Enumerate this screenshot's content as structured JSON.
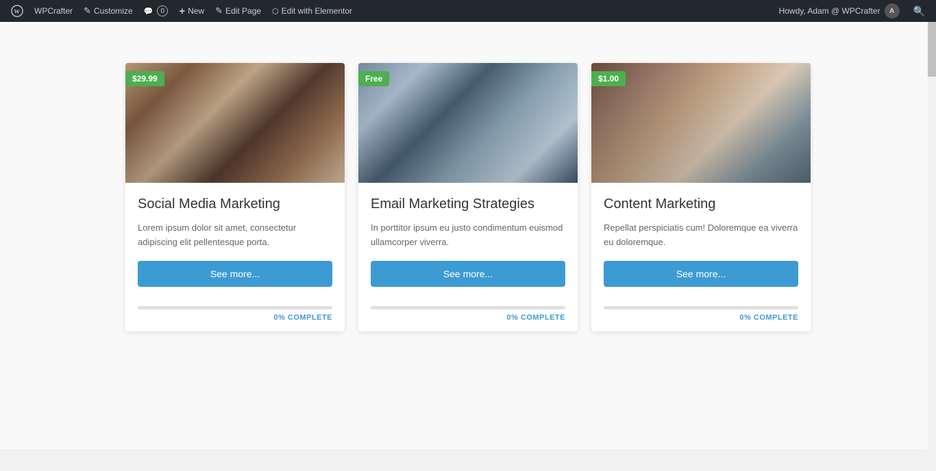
{
  "adminbar": {
    "wp_logo": "W",
    "site_name": "WPCrafter",
    "customize_label": "Customize",
    "comments_label": "0",
    "new_label": "New",
    "edit_page_label": "Edit Page",
    "edit_elementor_label": "Edit with Elementor",
    "howdy_text": "Howdy, Adam @ WPCrafter",
    "search_icon": "search"
  },
  "cards": [
    {
      "id": "card-1",
      "price": "$29.99",
      "title": "Social Media Marketing",
      "description": "Lorem ipsum dolor sit amet, consectetur adipiscing elit pellentesque porta.",
      "button_label": "See more...",
      "progress": 0,
      "complete_label": "0% COMPLETE",
      "img_class": "card-img-1"
    },
    {
      "id": "card-2",
      "price": "Free",
      "title": "Email Marketing Strategies",
      "description": "In porttitor ipsum eu justo condimentum euismod ullamcorper viverra.",
      "button_label": "See more...",
      "progress": 0,
      "complete_label": "0% COMPLETE",
      "img_class": "card-img-2"
    },
    {
      "id": "card-3",
      "price": "$1.00",
      "title": "Content Marketing",
      "description": "Repellat perspiciatis cum! Doloremque ea viverra eu doloremque.",
      "button_label": "See more...",
      "progress": 0,
      "complete_label": "0% COMPLETE",
      "img_class": "card-img-3"
    }
  ]
}
